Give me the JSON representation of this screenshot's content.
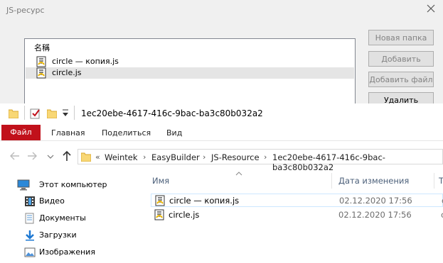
{
  "dialog": {
    "title": "JS-ресурс",
    "list_header": "名稱",
    "files": [
      {
        "name": "circle — копия.js",
        "selected": false
      },
      {
        "name": "circle.js",
        "selected": true
      }
    ],
    "buttons": {
      "new_folder": "Новая папка",
      "add_folder": "Добавить папку",
      "add_file": "Добавить файл",
      "delete": "Удалить"
    }
  },
  "explorer": {
    "window_title": "1ec20ebe-4617-416c-9bac-ba3c80b032a2",
    "ribbon_tabs": {
      "file": "Файл",
      "home": "Главная",
      "share": "Поделиться",
      "view": "Вид"
    },
    "breadcrumb": {
      "overflow": "«",
      "parts": [
        "Weintek",
        "EasyBuilder",
        "JS-Resource",
        "1ec20ebe-4617-416c-9bac-ba3c80b032a2"
      ]
    },
    "nav": [
      {
        "label": "Этот компьютер",
        "icon": "computer-icon"
      },
      {
        "label": "Видео",
        "icon": "video-icon"
      },
      {
        "label": "Документы",
        "icon": "documents-icon"
      },
      {
        "label": "Загрузки",
        "icon": "downloads-icon"
      },
      {
        "label": "Изображения",
        "icon": "pictures-icon"
      }
    ],
    "columns": {
      "name": "Имя",
      "date": "Дата изменения",
      "type": "Т"
    },
    "files": [
      {
        "name": "circle — копия.js",
        "date": "02.12.2020 17:56",
        "type": "с"
      },
      {
        "name": "circle.js",
        "date": "02.12.2020 17:56",
        "type": "с"
      }
    ]
  },
  "colors": {
    "file_tab": "#c1111b",
    "folder": "#f8d775",
    "accent": "#0078d7"
  }
}
